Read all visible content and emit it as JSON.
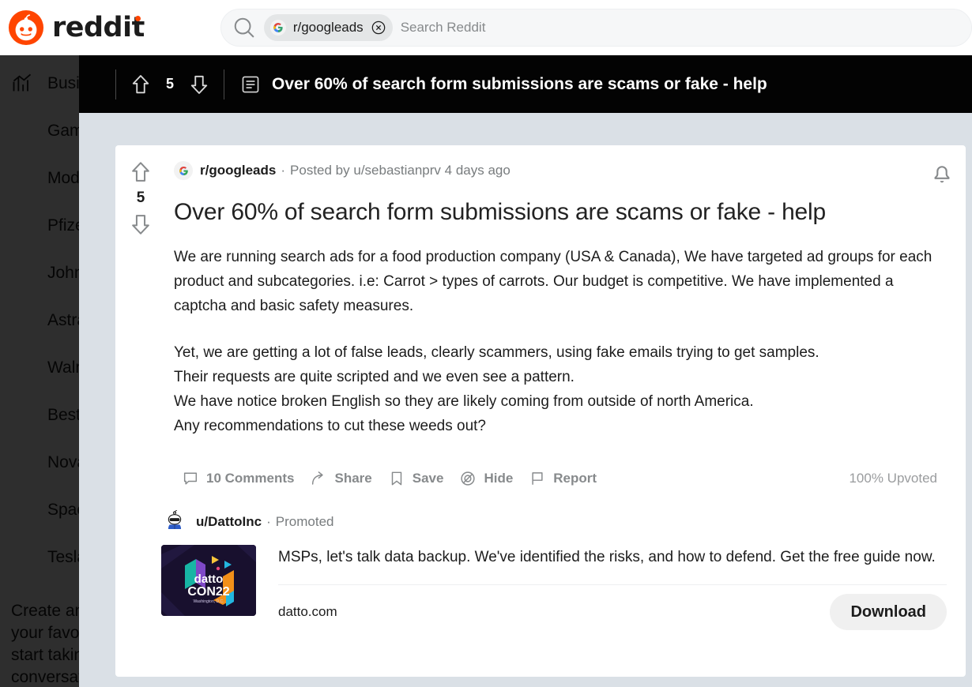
{
  "brand": {
    "name": "reddit",
    "logo_icon": "reddit-snoo-logo",
    "accent": "#ff4500"
  },
  "search": {
    "search_icon": "search-icon",
    "chip_label": "r/googleads",
    "chip_icon": "googleads-subreddit-icon",
    "clear_icon": "close-circle-icon",
    "placeholder": "Search Reddit",
    "value": ""
  },
  "sidebar": {
    "items": [
      {
        "label": "Business",
        "icon": "trending-chart-icon"
      },
      {
        "label": "Gaming",
        "icon": ""
      },
      {
        "label": "Moderna",
        "icon": ""
      },
      {
        "label": "Pfizer",
        "icon": ""
      },
      {
        "label": "Johnson",
        "icon": ""
      },
      {
        "label": "AstraZeneca",
        "icon": ""
      },
      {
        "label": "Walmart",
        "icon": ""
      },
      {
        "label": "Best of",
        "icon": ""
      },
      {
        "label": "Novavax",
        "icon": ""
      },
      {
        "label": "SpaceX",
        "icon": ""
      },
      {
        "label": "Tesla",
        "icon": ""
      }
    ],
    "blurb": "Create an account to follow your favorite communities and start taking part in conversations."
  },
  "sticky_bar": {
    "score": "5",
    "upvote_icon": "upvote-arrow-icon",
    "downvote_icon": "downvote-arrow-icon",
    "post_type_icon": "text-post-icon",
    "title": "Over 60% of search form submissions are scams or fake - help",
    "background": "#030303"
  },
  "post": {
    "score": "5",
    "upvote_icon": "upvote-arrow-icon",
    "downvote_icon": "downvote-arrow-icon",
    "subreddit": "r/googleads",
    "subreddit_icon": "googleads-subreddit-icon",
    "separator": "·",
    "byline": "Posted by u/sebastianprv 4 days ago",
    "title": "Over 60% of search form submissions are scams or fake - help",
    "bell_icon": "notification-bell-icon",
    "paragraph1": "We are running search ads for a food production company (USA & Canada), We have targeted ad groups for each product and subcategories. i.e: Carrot > types of carrots. Our budget is competitive. We have implemented a captcha and basic safety measures.",
    "paragraph2_lines": [
      "Yet, we are getting a lot of false leads, clearly scammers, using fake emails trying to get samples.",
      "Their requests are quite scripted and we even see a pattern.",
      "We have notice broken English so they are likely coming from outside of north America.",
      "Any recommendations to cut these weeds out?"
    ],
    "actions": [
      {
        "label": "10 Comments",
        "icon": "comment-bubble-icon"
      },
      {
        "label": "Share",
        "icon": "share-arrow-icon"
      },
      {
        "label": "Save",
        "icon": "bookmark-icon"
      },
      {
        "label": "Hide",
        "icon": "eye-off-icon"
      },
      {
        "label": "Report",
        "icon": "flag-icon"
      }
    ],
    "upvoted_percent": "100% Upvoted"
  },
  "ad": {
    "avatar_icon": "snoo-sunglasses-avatar-icon",
    "username": "u/DattoInc",
    "separator": "·",
    "promoted_label": "Promoted",
    "thumbnail_icon": "dattocon22-ad-thumbnail",
    "thumbnail_text_top": "datto",
    "thumbnail_text_mid": "CON22",
    "thumbnail_text_bot": "Washington, D.C.",
    "body": "MSPs, let's talk data backup. We've identified the risks, and how to defend. Get the free guide now.",
    "domain": "datto.com",
    "cta_label": "Download"
  },
  "colors": {
    "page_background": "#dae0e6",
    "card_background": "#ffffff",
    "reddit_orange": "#ff4500",
    "muted_text": "#787c7e"
  }
}
